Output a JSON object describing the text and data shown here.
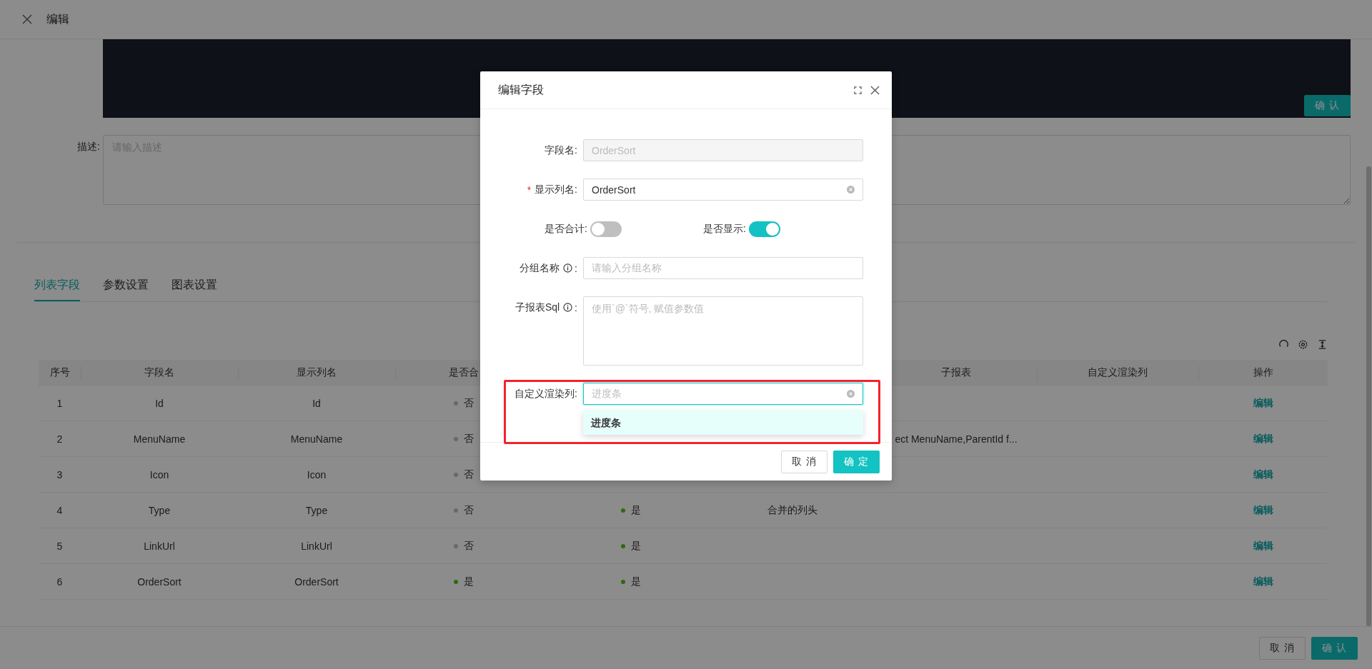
{
  "header": {
    "title": "编辑"
  },
  "panel": {
    "button": "确 认"
  },
  "description": {
    "label": "描述:",
    "placeholder": "请输入描述"
  },
  "tabs": [
    {
      "label": "列表字段",
      "selected": true
    },
    {
      "label": "参数设置",
      "selected": false
    },
    {
      "label": "图表设置",
      "selected": false
    }
  ],
  "table": {
    "columns": [
      {
        "label": "序号"
      },
      {
        "label": "字段名"
      },
      {
        "label": "显示列名"
      },
      {
        "label": "是否合"
      },
      {
        "label": "子报表"
      },
      {
        "label": "自定义渲染列"
      },
      {
        "label": "操作"
      }
    ],
    "rows": [
      {
        "no": "1",
        "field": "Id",
        "display": "Id",
        "sum": {
          "text": "否",
          "on": false
        },
        "action": "编辑"
      },
      {
        "no": "2",
        "field": "MenuName",
        "display": "MenuName",
        "sum": {
          "text": "否",
          "on": false
        },
        "subreport": "ect MenuName,ParentId f...",
        "action": "编辑"
      },
      {
        "no": "3",
        "field": "Icon",
        "display": "Icon",
        "sum": {
          "text": "否",
          "on": false
        },
        "action": "编辑"
      },
      {
        "no": "4",
        "field": "Type",
        "display": "Type",
        "sum": {
          "text": "否",
          "on": false
        },
        "show": {
          "text": "是",
          "on": true
        },
        "group": "合并的列头",
        "action": "编辑"
      },
      {
        "no": "5",
        "field": "LinkUrl",
        "display": "LinkUrl",
        "sum": {
          "text": "否",
          "on": false
        },
        "show": {
          "text": "是",
          "on": true
        },
        "action": "编辑"
      },
      {
        "no": "6",
        "field": "OrderSort",
        "display": "OrderSort",
        "sum": {
          "text": "是",
          "on": true
        },
        "show": {
          "text": "是",
          "on": true
        },
        "action": "编辑"
      }
    ]
  },
  "footer": {
    "buttons": [
      {
        "label": "取 消",
        "kind": "default"
      },
      {
        "label": "确 认",
        "kind": "primary"
      }
    ]
  },
  "dialog": {
    "title": "编辑字段",
    "fields": [
      {
        "kind": "input",
        "label": "字段名:",
        "value": "OrderSort",
        "disabled": true
      },
      {
        "kind": "input",
        "label": "显示列名:",
        "mark": "*",
        "value": "OrderSort",
        "disabled": false,
        "clearable": true
      },
      {
        "kind": "switches",
        "items": [
          {
            "label": "是否合计:",
            "on": false
          },
          {
            "label": "是否显示:",
            "on": true
          }
        ]
      },
      {
        "kind": "input",
        "label": "分组名称",
        "info": true,
        "suffix": ":",
        "placeholder": "请输入分组名称"
      },
      {
        "kind": "textarea",
        "label": "子报表Sql",
        "info": true,
        "suffix": ":",
        "placeholder": "使用`@`符号, 赋值参数值"
      },
      {
        "kind": "select",
        "label": "自定义渲染列:",
        "placeholder": "进度条",
        "focused": true,
        "clearable": true,
        "highlight": true,
        "options": [
          {
            "label": "进度条",
            "selected": true
          }
        ]
      }
    ],
    "buttons": [
      {
        "label": "取 消",
        "kind": "default"
      },
      {
        "label": "确 定",
        "kind": "primary"
      }
    ]
  }
}
